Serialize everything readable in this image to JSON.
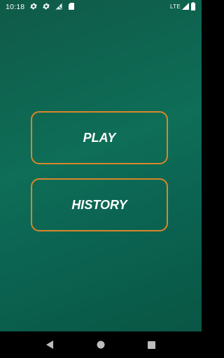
{
  "status_bar": {
    "time": "10:18",
    "network": "LTE",
    "icons": [
      "settings-icon",
      "settings-icon",
      "signal-off-icon",
      "sd-card-icon",
      "lte-signal-icon",
      "battery-icon"
    ]
  },
  "menu": {
    "play_label": "PLAY",
    "history_label": "HISTORY",
    "border_color": "#d9862a",
    "text_color": "#ffffff"
  },
  "background": {
    "color_dark": "#0f5a48",
    "color_light": "#0e6e57"
  },
  "nav_bar": {
    "icons": [
      "back-icon",
      "home-icon",
      "recents-icon"
    ]
  }
}
